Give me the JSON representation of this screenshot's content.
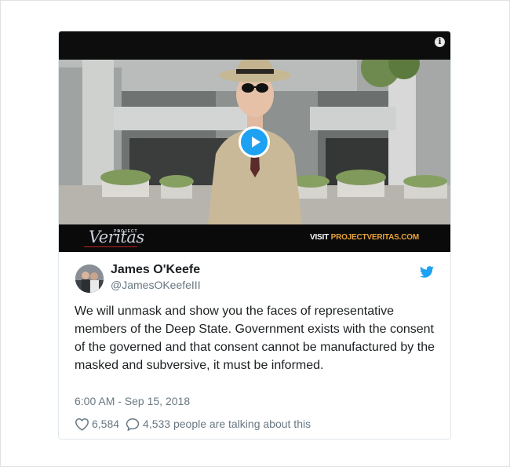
{
  "media": {
    "logo_small": "PROJECT",
    "logo": "Veritas",
    "visit_prefix": "VISIT",
    "visit_site": "PROJECTVERITAS.COM",
    "info_glyph": "i"
  },
  "tweet": {
    "author_name": "James O'Keefe",
    "author_handle": "@JamesOKeefeIII",
    "text": "We will unmask and show you the faces of representative members of the Deep State. Government exists with the consent of the governed and that consent cannot be manufactured by the masked and subversive, it must be informed.",
    "timestamp": "6:00 AM - Sep 15, 2018",
    "likes": "6,584",
    "talking": "4,533 people are talking about this"
  },
  "icons": {
    "info": "info-icon",
    "play": "play-icon",
    "twitter": "twitter-bird-icon",
    "heart": "heart-icon",
    "comment": "comment-icon"
  },
  "colors": {
    "accent": "#1da1f2",
    "text": "#1c2022",
    "muted": "#697882",
    "visit_site": "#e8a23a"
  }
}
